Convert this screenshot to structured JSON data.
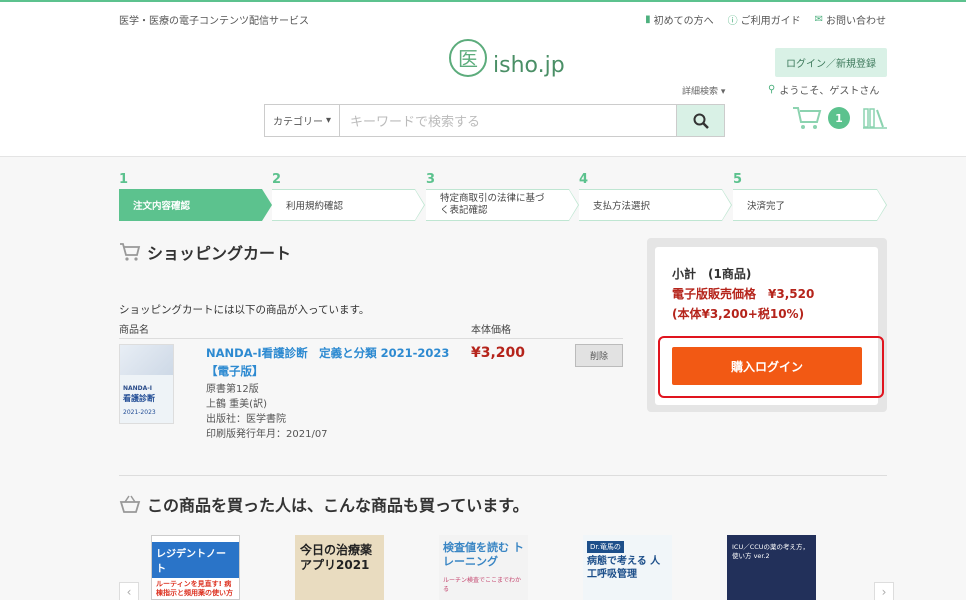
{
  "header": {
    "tagline": "医学・医療の電子コンテンツ配信サービス",
    "links": [
      {
        "icon": "first-time-icon",
        "label": "初めての方へ"
      },
      {
        "icon": "help-icon",
        "label": "ご利用ガイド"
      },
      {
        "icon": "mail-icon",
        "label": "お問い合わせ"
      }
    ],
    "logo_mark": "医",
    "logo_text": "isho.jp",
    "login_label": "ログイン／新規登録",
    "advanced_search": "詳細検索",
    "welcome": "ようこそ、ゲストさん",
    "search": {
      "category": "カテゴリー",
      "placeholder": "キーワードで検索する"
    },
    "cart_count": "1"
  },
  "steps": [
    {
      "num": "1",
      "label": "注文内容確認",
      "active": true
    },
    {
      "num": "2",
      "label": "利用規約確認",
      "active": false
    },
    {
      "num": "3",
      "label": "特定商取引の法律に基づく表記確認",
      "active": false
    },
    {
      "num": "4",
      "label": "支払方法選択",
      "active": false
    },
    {
      "num": "5",
      "label": "決済完了",
      "active": false
    }
  ],
  "cart": {
    "title": "ショッピングカート",
    "message": "ショッピングカートには以下の商品が入っています。",
    "col_name": "商品名",
    "col_price": "本体価格",
    "item": {
      "title": "NANDA-I看護診断　定義と分類 2021-2023【電子版】",
      "meta": [
        "原書第12版",
        "上鶴 重美(訳)",
        "出版社：医学書院",
        "印刷版発行年月：2021/07"
      ],
      "price": "¥3,200",
      "delete_label": "削除",
      "cover": {
        "line1": "NANDA-I",
        "line2": "看護診断",
        "line3": "2021-2023"
      }
    }
  },
  "summary": {
    "subtotal": "小計　(1商品)",
    "price_line": "電子版販売価格　¥3,520",
    "tax_line": "(本体¥3,200+税10%)",
    "buy_label": "購入ログイン"
  },
  "recommend": {
    "title": "この商品を買った人は、こんな商品も買っています。",
    "books": [
      {
        "title": "レジデントノート",
        "sub": "ルーティンを見直す! 病棟指示と頻用薬の使い方"
      },
      {
        "title": "今日の治療薬アプリ2021"
      },
      {
        "title": "検査値を読む トレーニング",
        "sub": "ルーチン検査でここまでわかる"
      },
      {
        "title": "病態で考える 人工呼吸管理",
        "sub": "Dr.竜馬の"
      },
      {
        "title": "ICU／CCUの薬の考え方，使い方 ver.2"
      }
    ]
  },
  "colors": {
    "accent": "#5cc28e",
    "buy": "#f25914",
    "price": "#b5241b",
    "highlight": "#e0141e"
  }
}
